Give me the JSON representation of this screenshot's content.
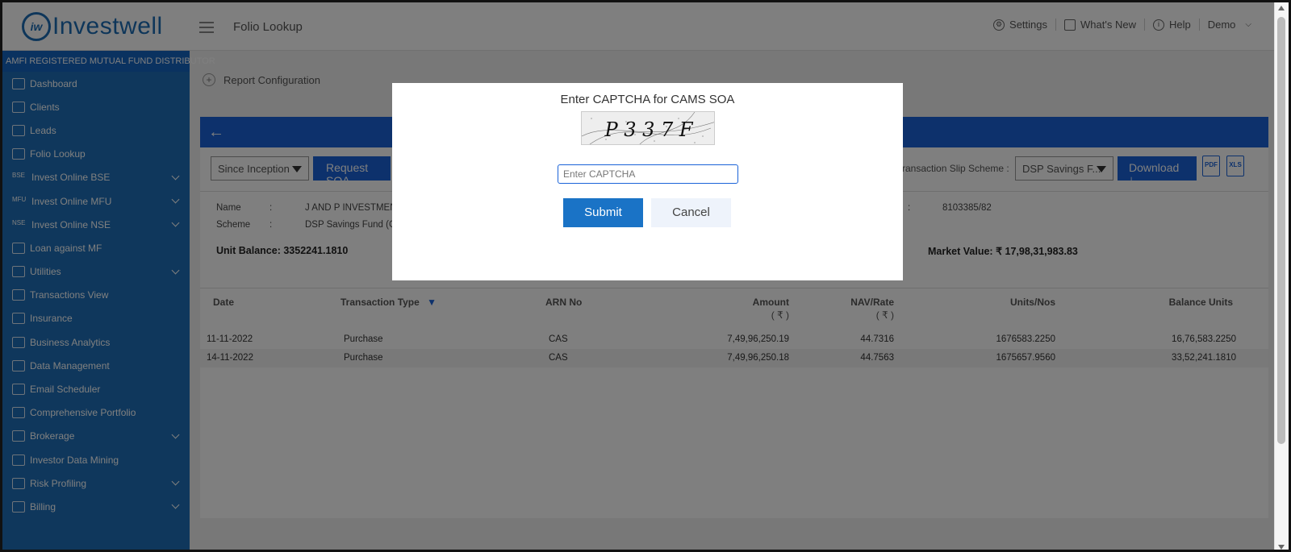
{
  "header": {
    "logo_mark": "iw",
    "logo_text": "Investwell",
    "page_title": "Folio Lookup",
    "nav": [
      {
        "label": "Settings",
        "icon": "gear-icon"
      },
      {
        "label": "What's New",
        "icon": "message-icon"
      },
      {
        "label": "Help",
        "icon": "help-icon"
      },
      {
        "label": "Demo",
        "icon": "chevron-down-icon"
      }
    ]
  },
  "sidebar": {
    "heading": "AMFI REGISTERED MUTUAL FUND DISTRIBUTOR",
    "items": [
      {
        "label": "Dashboard",
        "icon": "home-icon",
        "expandable": false
      },
      {
        "label": "Clients",
        "icon": "users-icon",
        "expandable": false
      },
      {
        "label": "Leads",
        "icon": "leads-icon",
        "expandable": false
      },
      {
        "label": "Folio Lookup",
        "icon": "folio-icon",
        "expandable": false
      },
      {
        "label": "Invest Online BSE",
        "icon": "bse-icon",
        "icon_text": "BSE",
        "expandable": true
      },
      {
        "label": "Invest Online MFU",
        "icon": "mfu-icon",
        "icon_text": "MFU",
        "expandable": true
      },
      {
        "label": "Invest Online NSE",
        "icon": "nse-icon",
        "icon_text": "NSE",
        "expandable": true
      },
      {
        "label": "Loan against MF",
        "icon": "loan-icon",
        "expandable": false
      },
      {
        "label": "Utilities",
        "icon": "utilities-icon",
        "expandable": true
      },
      {
        "label": "Transactions View",
        "icon": "transactions-icon",
        "expandable": false
      },
      {
        "label": "Insurance",
        "icon": "insurance-icon",
        "expandable": false
      },
      {
        "label": "Business Analytics",
        "icon": "analytics-icon",
        "expandable": false
      },
      {
        "label": "Data Management",
        "icon": "data-icon",
        "expandable": false
      },
      {
        "label": "Email Scheduler",
        "icon": "email-icon",
        "expandable": false
      },
      {
        "label": "Comprehensive Portfolio",
        "icon": "portfolio-icon",
        "expandable": false
      },
      {
        "label": "Brokerage",
        "icon": "brokerage-icon",
        "expandable": true
      },
      {
        "label": "Investor Data Mining",
        "icon": "mining-icon",
        "expandable": false
      },
      {
        "label": "Risk Profiling",
        "icon": "risk-icon",
        "expandable": true
      },
      {
        "label": "Billing",
        "icon": "billing-icon",
        "expandable": true
      }
    ]
  },
  "main": {
    "report_config": "Report Configuration",
    "period_select": "Since Inception",
    "request_soa": "Request SOA",
    "slip_label": "ransaction Slip Scheme :",
    "scheme_select": "DSP Savings F...",
    "download": "Download",
    "pdf": "PDF",
    "xls": "XLS",
    "info": {
      "name_label": "Name",
      "name_colon": ":",
      "name_value": "J AND P INVESTMEN",
      "scheme_label": "Scheme",
      "scheme_colon": ":",
      "scheme_value": "DSP Savings Fund (G)",
      "folio_colon": ":",
      "folio_value": "8103385/82",
      "unit_balance": "Unit Balance: 3352241.1810",
      "market_value": "Market Value: ₹ 17,98,31,983.83"
    },
    "table": {
      "headers": {
        "date": "Date",
        "type": "Transaction Type",
        "arn": "ARN No",
        "amount": "Amount",
        "amount_unit": "( ₹ )",
        "nav": "NAV/Rate",
        "nav_unit": "( ₹ )",
        "units": "Units/Nos",
        "balance": "Balance Units"
      },
      "rows": [
        {
          "date": "11-11-2022",
          "type": "Purchase",
          "arn": "CAS",
          "amount": "7,49,96,250.19",
          "nav": "44.7316",
          "units": "1676583.2250",
          "balance": "16,76,583.2250"
        },
        {
          "date": "14-11-2022",
          "type": "Purchase",
          "arn": "CAS",
          "amount": "7,49,96,250.18",
          "nav": "44.7563",
          "units": "1675657.9560",
          "balance": "33,52,241.1810"
        }
      ]
    }
  },
  "modal": {
    "title": "Enter CAPTCHA for CAMS SOA",
    "captcha_text": "P 3 3 7 F",
    "input_placeholder": "Enter CAPTCHA",
    "submit": "Submit",
    "cancel": "Cancel"
  }
}
